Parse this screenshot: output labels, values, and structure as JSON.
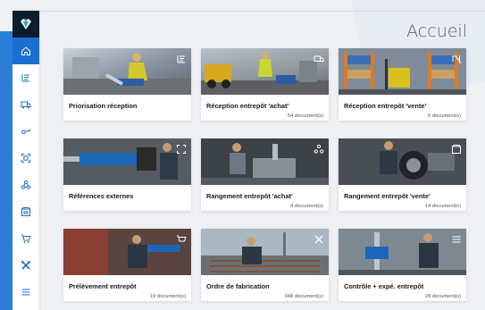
{
  "page": {
    "title": "Accueil"
  },
  "sidebar": {
    "items": [
      {
        "name": "home"
      },
      {
        "name": "priorisation"
      },
      {
        "name": "reception"
      },
      {
        "name": "keys"
      },
      {
        "name": "scan"
      },
      {
        "name": "network"
      },
      {
        "name": "archive"
      },
      {
        "name": "cart"
      },
      {
        "name": "tools"
      },
      {
        "name": "list"
      }
    ]
  },
  "cards": [
    {
      "title": "Priorisation réception",
      "count": ""
    },
    {
      "title": "Réception entrepôt 'achat'",
      "count": "54 document(s)"
    },
    {
      "title": "Réception entrepôt 'vente'",
      "count": "6 document(s)"
    },
    {
      "title": "Références externes",
      "count": ""
    },
    {
      "title": "Rangement entrepôt 'achat'",
      "count": "4 document(s)"
    },
    {
      "title": "Rangement entrepôt 'vente'",
      "count": "14 document(s)"
    },
    {
      "title": "Prélèvement entrepôt",
      "count": "19 document(s)"
    },
    {
      "title": "Ordre de fabrication",
      "count": "348 document(s)"
    },
    {
      "title": "Contrôle + expé. entrepôt",
      "count": "28 document(s)"
    }
  ],
  "colors": {
    "accent": "#1a6fd1",
    "logo_bg": "#0b1d2e"
  }
}
